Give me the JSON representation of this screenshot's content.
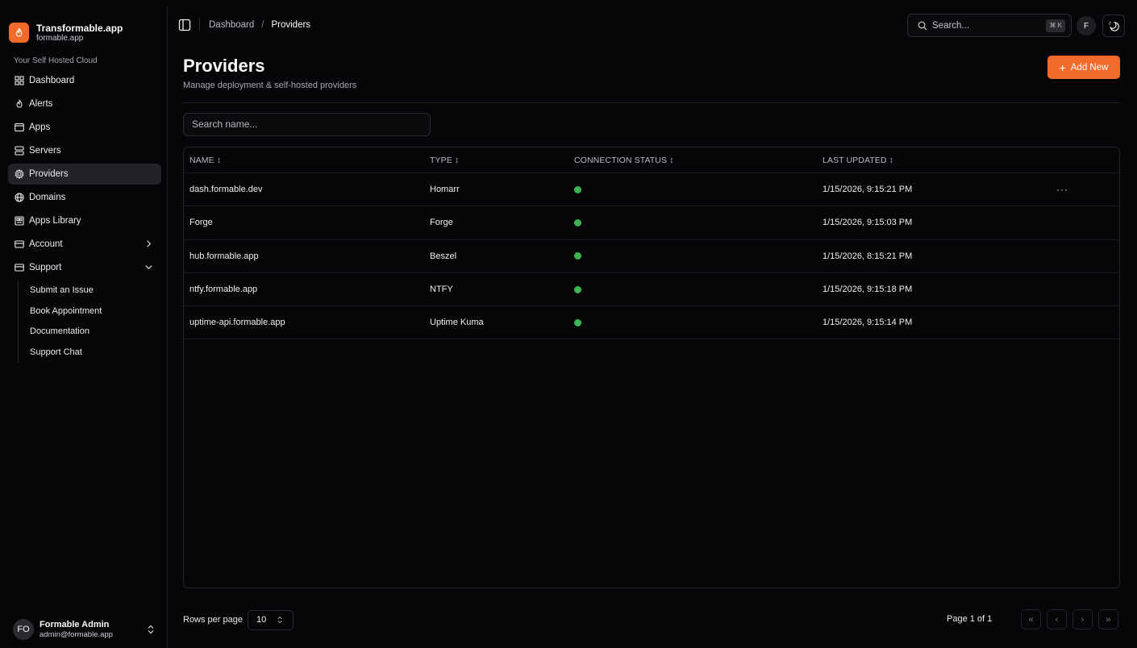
{
  "brand": {
    "title": "Transformable.app",
    "subtitle": "formable.app",
    "logo_icon": "flame-icon",
    "accent": "#f26b2a"
  },
  "sidebar": {
    "section_label": "Your Self Hosted Cloud",
    "items": [
      {
        "label": "Dashboard",
        "icon": "dashboard-grid-icon"
      },
      {
        "label": "Alerts",
        "icon": "flame-icon"
      },
      {
        "label": "Apps",
        "icon": "window-icon"
      },
      {
        "label": "Servers",
        "icon": "server-icon"
      },
      {
        "label": "Providers",
        "icon": "gear-icon",
        "active": true
      },
      {
        "label": "Domains",
        "icon": "globe-icon"
      },
      {
        "label": "Apps Library",
        "icon": "library-icon"
      },
      {
        "label": "Account",
        "icon": "card-icon",
        "expandable": true
      },
      {
        "label": "Support",
        "icon": "card-icon",
        "expanded": true
      }
    ],
    "support_sub": [
      "Submit an Issue",
      "Book Appointment",
      "Documentation",
      "Support Chat"
    ]
  },
  "user": {
    "initials": "FO",
    "name": "Formable Admin",
    "email": "admin@formable.app"
  },
  "topbar": {
    "breadcrumb": [
      "Dashboard",
      "Providers"
    ],
    "breadcrumb_sep": "/",
    "search_placeholder": "Search...",
    "search_shortcut": "⌘ K",
    "avatar_initial": "F"
  },
  "page": {
    "title": "Providers",
    "subtitle": "Manage deployment & self-hosted providers",
    "add_button": "Add New",
    "add_icon": "+",
    "name_search_placeholder": "Search name..."
  },
  "table": {
    "columns": [
      "NAME ↕",
      "TYPE ↕",
      "CONNECTION STATUS ↕",
      "LAST UPDATED ↕"
    ],
    "rows": [
      {
        "name": "dash.formable.dev",
        "type": "Homarr",
        "status": "connected",
        "updated": "1/15/2026, 9:15:21 PM",
        "menu": "···"
      },
      {
        "name": "Forge",
        "type": "Forge",
        "status": "connected",
        "updated": "1/15/2026, 9:15:03 PM"
      },
      {
        "name": "hub.formable.app",
        "type": "Beszel",
        "status": "connected",
        "updated": "1/15/2026, 8:15:21 PM"
      },
      {
        "name": "ntfy.formable.app",
        "type": "NTFY",
        "status": "connected",
        "updated": "1/15/2026, 9:15:18 PM"
      },
      {
        "name": "uptime-api.formable.app",
        "type": "Uptime Kuma",
        "status": "connected",
        "updated": "1/15/2026, 9:15:14 PM"
      }
    ],
    "status_color": "#3bb554"
  },
  "pagination": {
    "rows_per_page_label": "Rows per page",
    "rows_per_page": "10",
    "page_label": "Page 1 of 1",
    "first": "«",
    "prev": "‹",
    "next": "›",
    "last": "»"
  }
}
